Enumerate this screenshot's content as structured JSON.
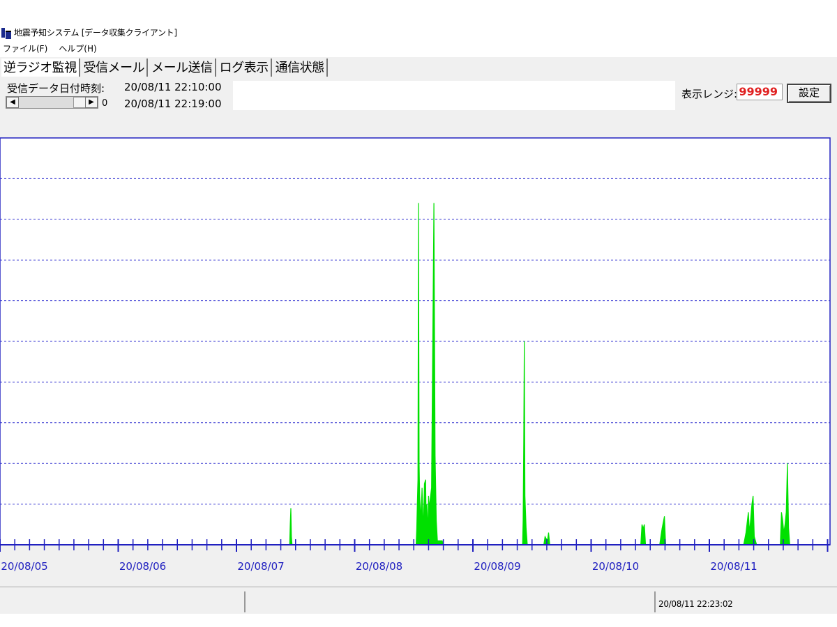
{
  "window": {
    "title": "地震予知システム [データ収集クライアント]"
  },
  "menu": {
    "file": "ファイル(F)",
    "help": "ヘルプ(H)"
  },
  "tabs": [
    {
      "label": "逆ラジオ監視",
      "active": true
    },
    {
      "label": "受信メール",
      "active": false
    },
    {
      "label": "メール送信",
      "active": false
    },
    {
      "label": "ログ表示",
      "active": false
    },
    {
      "label": "通信状態",
      "active": false
    }
  ],
  "controls": {
    "date_label": "受信データ日付時刻:",
    "datetime_from": "20/08/11 22:10:00",
    "datetime_to": "20/08/11 22:19:00",
    "scroll_value": "0",
    "range_label": "表示レンジ:",
    "range_value": "99999",
    "set_button": "設定"
  },
  "colors": {
    "plot_line": "#00e000",
    "grid": "#3030d0",
    "axis": "#2020c0",
    "range_text": "#e02020"
  },
  "chart_data": {
    "type": "area",
    "x_tick_labels": [
      "20/08/05",
      "20/08/06",
      "20/08/07",
      "20/08/08",
      "20/08/09",
      "20/08/10",
      "20/08/11"
    ],
    "ylim": [
      0,
      10
    ],
    "grid": true,
    "series": [
      {
        "values": [
          [
            2.45,
            0.0
          ],
          [
            2.455,
            0.5
          ],
          [
            2.46,
            0.9
          ],
          [
            2.465,
            0.2
          ],
          [
            2.47,
            0.0
          ],
          [
            3.52,
            0.0
          ],
          [
            3.525,
            0.4
          ],
          [
            3.53,
            1.0
          ],
          [
            3.535,
            1.6
          ],
          [
            3.54,
            8.4
          ],
          [
            3.545,
            2.0
          ],
          [
            3.55,
            1.2
          ],
          [
            3.56,
            0.6
          ],
          [
            3.57,
            1.4
          ],
          [
            3.58,
            0.3
          ],
          [
            3.59,
            1.5
          ],
          [
            3.6,
            1.6
          ],
          [
            3.605,
            0.6
          ],
          [
            3.61,
            1.0
          ],
          [
            3.62,
            0.3
          ],
          [
            3.625,
            1.2
          ],
          [
            3.63,
            0.9
          ],
          [
            3.65,
            1.4
          ],
          [
            3.67,
            8.4
          ],
          [
            3.68,
            2.2
          ],
          [
            3.69,
            0.6
          ],
          [
            3.7,
            0.1
          ],
          [
            3.74,
            0.1
          ],
          [
            3.75,
            0.0
          ],
          [
            4.42,
            0.0
          ],
          [
            4.425,
            0.6
          ],
          [
            4.43,
            2.6
          ],
          [
            4.435,
            5.0
          ],
          [
            4.44,
            1.2
          ],
          [
            4.45,
            0.4
          ],
          [
            4.46,
            0.0
          ],
          [
            4.6,
            0.0
          ],
          [
            4.61,
            0.2
          ],
          [
            4.63,
            0.1
          ],
          [
            4.64,
            0.3
          ],
          [
            4.65,
            0.0
          ],
          [
            5.42,
            0.0
          ],
          [
            5.43,
            0.5
          ],
          [
            5.44,
            0.4
          ],
          [
            5.45,
            0.5
          ],
          [
            5.46,
            0.0
          ],
          [
            5.58,
            0.0
          ],
          [
            5.6,
            0.4
          ],
          [
            5.62,
            0.7
          ],
          [
            5.63,
            0.0
          ],
          [
            6.29,
            0.0
          ],
          [
            6.31,
            0.3
          ],
          [
            6.33,
            0.8
          ],
          [
            6.34,
            0.3
          ],
          [
            6.36,
            1.0
          ],
          [
            6.37,
            1.2
          ],
          [
            6.38,
            0.2
          ],
          [
            6.4,
            0.0
          ],
          [
            6.6,
            0.0
          ],
          [
            6.61,
            0.8
          ],
          [
            6.62,
            0.6
          ],
          [
            6.63,
            0.3
          ],
          [
            6.64,
            0.5
          ],
          [
            6.65,
            0.8
          ],
          [
            6.66,
            2.0
          ],
          [
            6.67,
            0.4
          ],
          [
            6.68,
            0.0
          ]
        ]
      }
    ]
  },
  "statusbar": {
    "datetime": "20/08/11 22:23:02"
  }
}
